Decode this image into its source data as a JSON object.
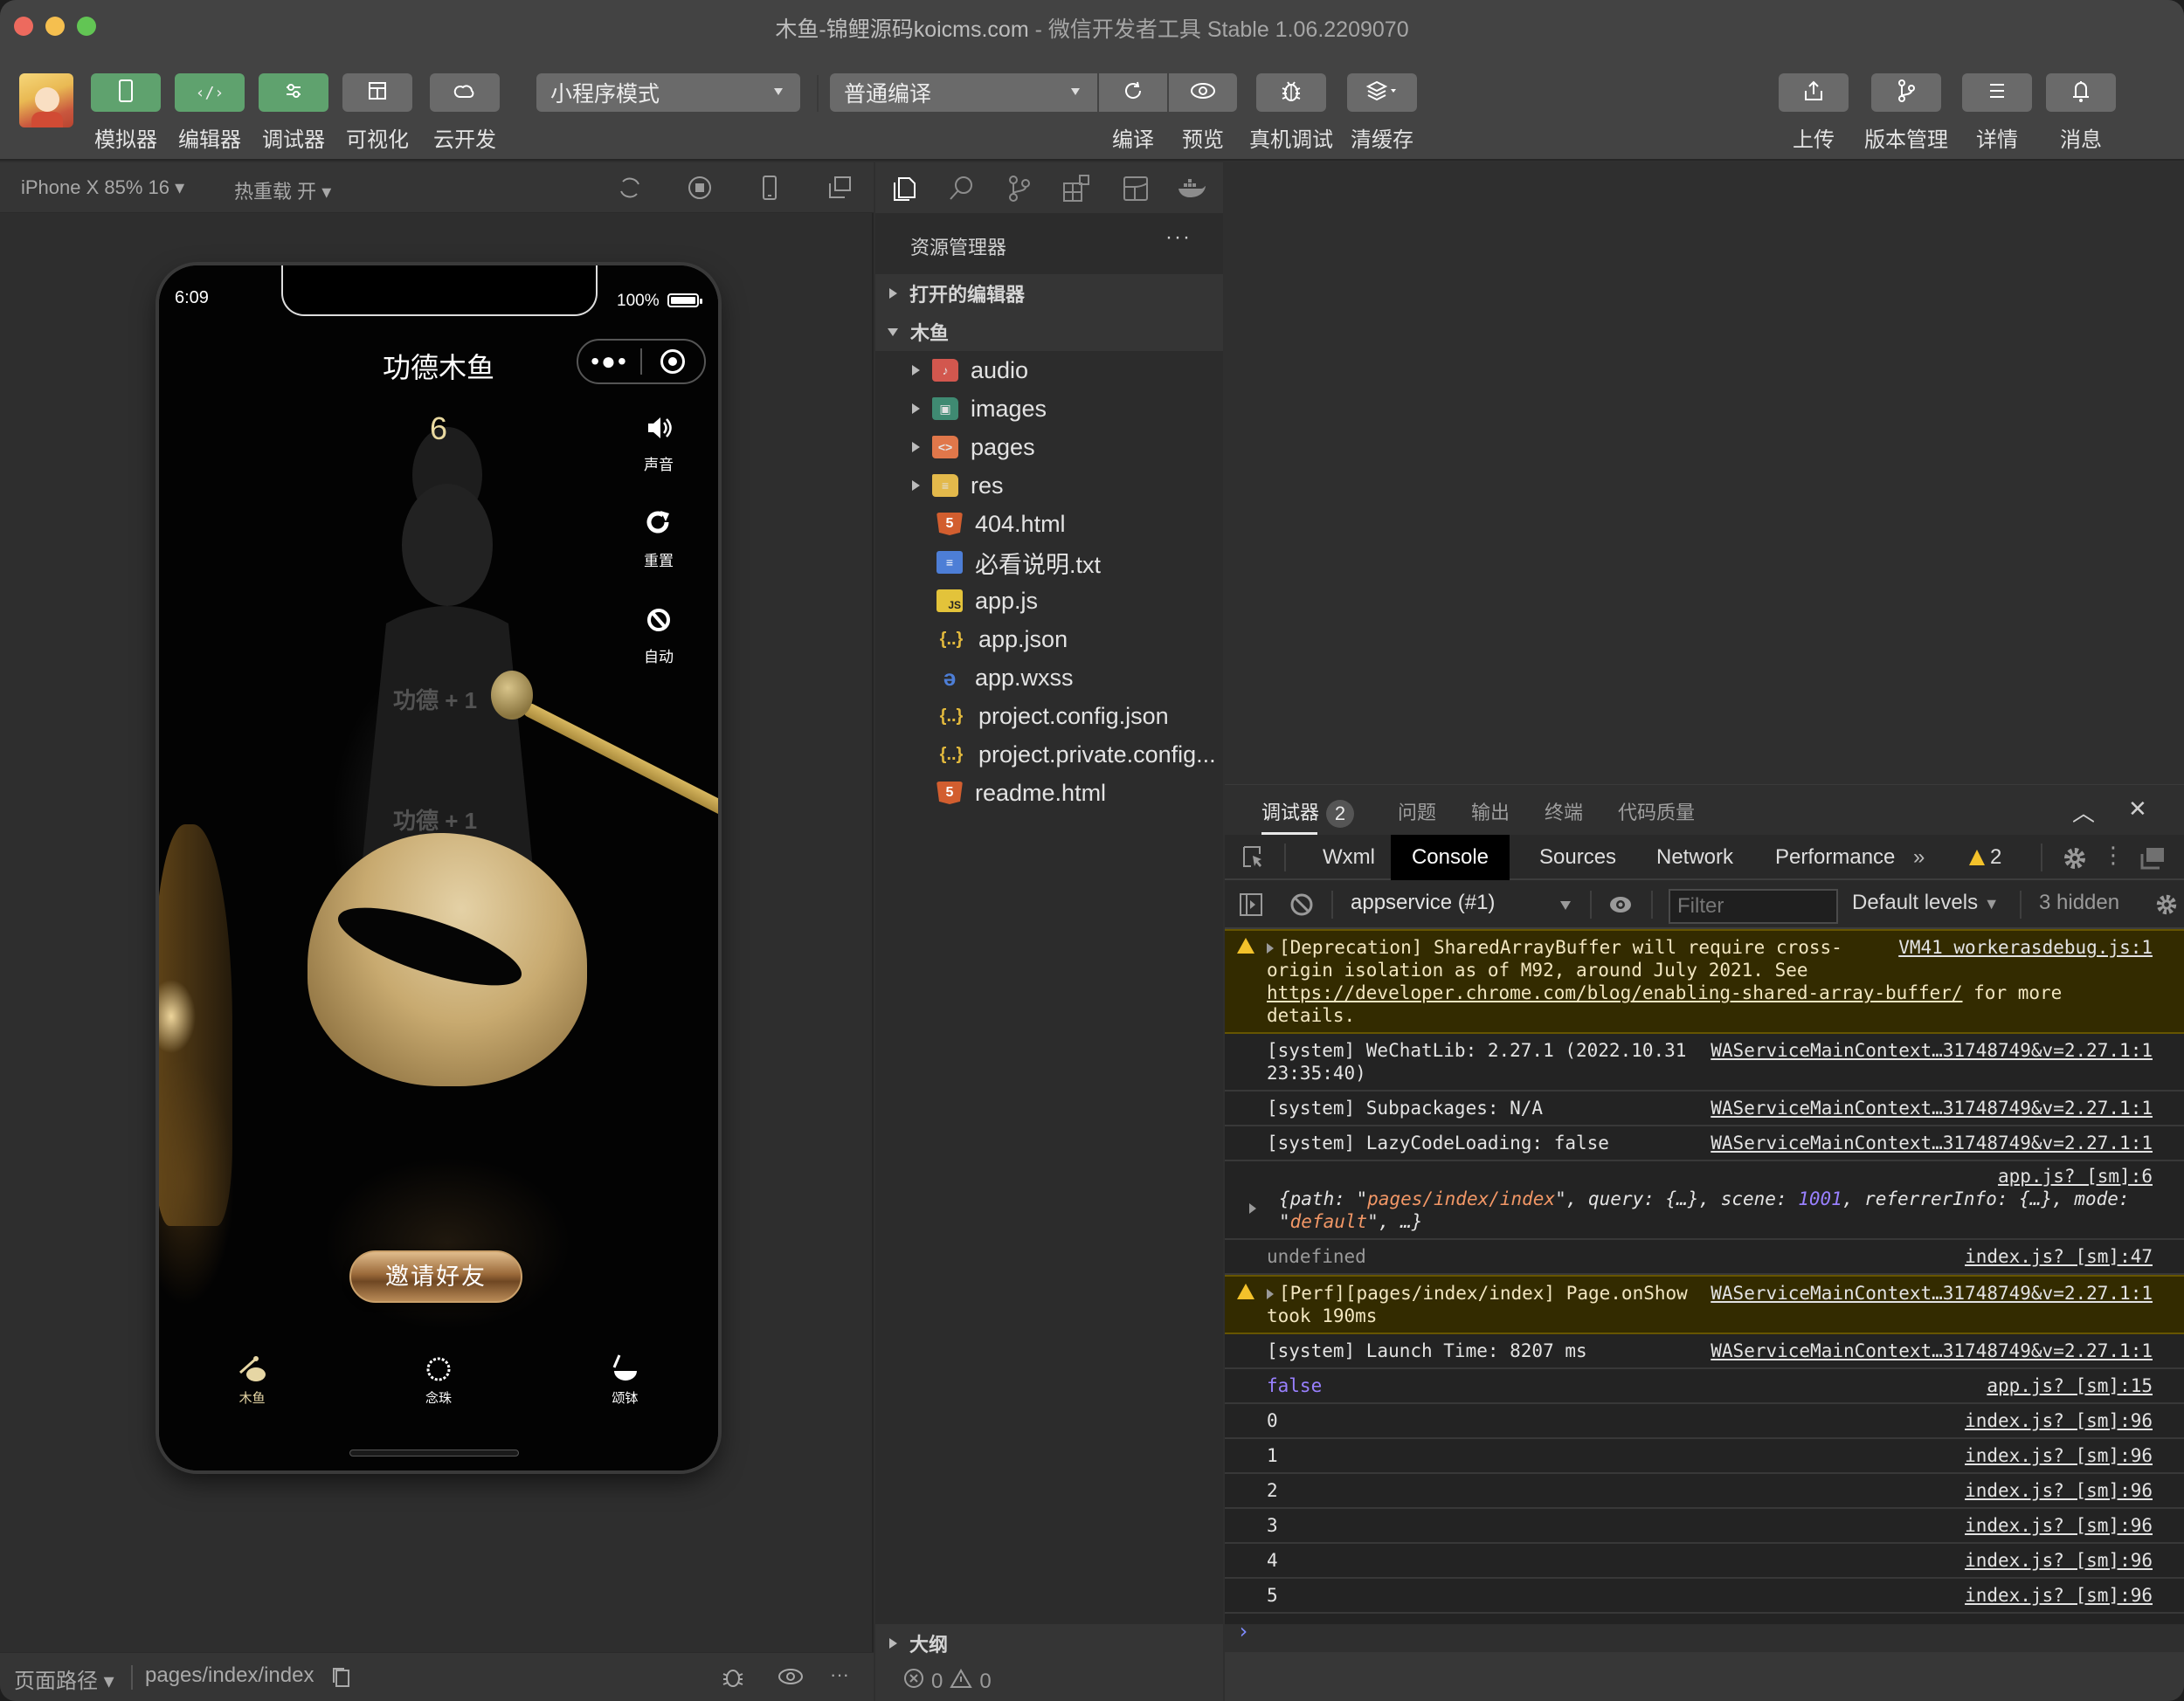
{
  "window": {
    "title_main": "木鱼-锦鲤源码koicms.com",
    "title_sep": " - ",
    "title_app": "微信开发者工具 Stable 1.06.2209070"
  },
  "toolbar": {
    "left_buttons": [
      {
        "label": "模拟器",
        "icon": "phone-icon",
        "active": true
      },
      {
        "label": "编辑器",
        "icon": "code-icon",
        "active": true
      },
      {
        "label": "调试器",
        "icon": "debug-sliders-icon",
        "active": true
      },
      {
        "label": "可视化",
        "icon": "layout-icon",
        "active": false
      },
      {
        "label": "云开发",
        "icon": "cloud-icon",
        "active": false
      }
    ],
    "mode_select": "小程序模式",
    "compile_select": "普通编译",
    "compile_label": "编译",
    "preview_label": "预览",
    "remote_debug_label": "真机调试",
    "clear_cache_label": "清缓存",
    "right_buttons": [
      {
        "label": "上传",
        "icon": "upload-icon"
      },
      {
        "label": "版本管理",
        "icon": "branch-icon"
      },
      {
        "label": "详情",
        "icon": "menu-icon"
      },
      {
        "label": "消息",
        "icon": "bell-icon"
      }
    ]
  },
  "simulator": {
    "device": "iPhone X 85% 16",
    "hot_reload": "热重载 开",
    "status_time": "6:09",
    "battery_text": "100%",
    "battery_level": 1.0,
    "page_title": "功德木鱼",
    "capsule_more": "•●•",
    "merit_count": "6",
    "side_buttons": [
      {
        "icon": "speaker-icon",
        "glyph": "🔊",
        "label": "声音"
      },
      {
        "icon": "reset-icon",
        "glyph": "↻",
        "label": "重置"
      },
      {
        "icon": "auto-icon",
        "glyph": "⟲",
        "label": "自动"
      }
    ],
    "merit_floats": [
      "功德 + 1",
      "功德 + 1"
    ],
    "invite_button": "邀请好友",
    "tabs": [
      {
        "label": "木鱼",
        "glyph": "⊘",
        "active": true
      },
      {
        "label": "念珠",
        "glyph": "◌",
        "active": false
      },
      {
        "label": "颂钵",
        "glyph": "◡",
        "active": false
      }
    ],
    "footer_route_label": "页面路径",
    "footer_path": "pages/index/index"
  },
  "explorer": {
    "title": "资源管理器",
    "more": "···",
    "open_editors": "打开的编辑器",
    "project": "木鱼",
    "items": [
      {
        "name": "audio",
        "type": "folder",
        "icon": "f-audio",
        "glyph": "♪"
      },
      {
        "name": "images",
        "type": "folder",
        "icon": "f-images",
        "glyph": "▣"
      },
      {
        "name": "pages",
        "type": "folder",
        "icon": "f-pages",
        "glyph": "<>"
      },
      {
        "name": "res",
        "type": "folder",
        "icon": "f-res",
        "glyph": "≡"
      },
      {
        "name": "404.html",
        "type": "file",
        "icon": "html5",
        "glyph": "5"
      },
      {
        "name": "必看说明.txt",
        "type": "file",
        "icon": "txt",
        "glyph": "≡"
      },
      {
        "name": "app.js",
        "type": "file",
        "icon": "js",
        "glyph": "JS"
      },
      {
        "name": "app.json",
        "type": "file",
        "icon": "json",
        "glyph": "{..}"
      },
      {
        "name": "app.wxss",
        "type": "file",
        "icon": "css",
        "glyph": "ǝ"
      },
      {
        "name": "project.config.json",
        "type": "file",
        "icon": "json",
        "glyph": "{..}"
      },
      {
        "name": "project.private.config...",
        "type": "file",
        "icon": "json",
        "glyph": "{..}"
      },
      {
        "name": "readme.html",
        "type": "file",
        "icon": "html5",
        "glyph": "5"
      }
    ],
    "outline": "大纲",
    "errors": "0",
    "warnings": "0"
  },
  "devtools": {
    "panel_tabs": [
      {
        "label": "调试器",
        "badge": "2",
        "active": true
      },
      {
        "label": "问题",
        "active": false
      },
      {
        "label": "输出",
        "active": false
      },
      {
        "label": "终端",
        "active": false
      },
      {
        "label": "代码质量",
        "active": false
      }
    ],
    "tabs": [
      "Wxml",
      "Console",
      "Sources",
      "Network",
      "Performance"
    ],
    "active_tab": "Console",
    "more_tabs": "»",
    "warning_count": "2",
    "context": "appservice (#1)",
    "filter_placeholder": "Filter",
    "levels": "Default levels",
    "hidden": "3 hidden",
    "messages": [
      {
        "level": "warning",
        "expandable": true,
        "text": "[Deprecation] SharedArrayBuffer will require cross-origin isolation as of M92, around July 2021. See ",
        "link": "https://developer.chrome.com/blog/enabling-shared-array-buffer/",
        "text_after": " for more details.",
        "source": "VM41 workerasdebug.js:1"
      },
      {
        "level": "info",
        "text": "[system] WeChatLib: 2.27.1 (2022.10.31 23:35:40)",
        "source": "WAServiceMainContext…31748749&v=2.27.1:1"
      },
      {
        "level": "info",
        "text": "[system] Subpackages: N/A",
        "source": "WAServiceMainContext…31748749&v=2.27.1:1"
      },
      {
        "level": "info",
        "text": "[system] LazyCodeLoading: false",
        "source": "WAServiceMainContext…31748749&v=2.27.1:1"
      },
      {
        "level": "object",
        "source": "app.js? [sm]:6",
        "path_val": "pages/index/index",
        "scene_val": "1001",
        "mode_val": "default"
      },
      {
        "level": "undefined",
        "text": "undefined",
        "source": "index.js? [sm]:47"
      },
      {
        "level": "warning",
        "expandable": true,
        "text": "[Perf][pages/index/index] Page.onShow took 190ms",
        "source": "WAServiceMainContext…31748749&v=2.27.1:1"
      },
      {
        "level": "info",
        "text": "[system] Launch Time: 8207 ms",
        "source": "WAServiceMainContext…31748749&v=2.27.1:1"
      },
      {
        "level": "boolean",
        "text": "false",
        "source": "app.js? [sm]:15"
      },
      {
        "level": "info",
        "text": "0",
        "source": "index.js? [sm]:96"
      },
      {
        "level": "info",
        "text": "1",
        "source": "index.js? [sm]:96"
      },
      {
        "level": "info",
        "text": "2",
        "source": "index.js? [sm]:96"
      },
      {
        "level": "info",
        "text": "3",
        "source": "index.js? [sm]:96"
      },
      {
        "level": "info",
        "text": "4",
        "source": "index.js? [sm]:96"
      },
      {
        "level": "info",
        "text": "5",
        "source": "index.js? [sm]:96"
      }
    ],
    "prompt": "›"
  },
  "colors": {
    "green_button": "#5fa26e",
    "console_warn_bg": "#332b00",
    "link_purple": "#9980ff",
    "string_orange": "#f29766",
    "merit_gold": "#e9d9a0"
  }
}
